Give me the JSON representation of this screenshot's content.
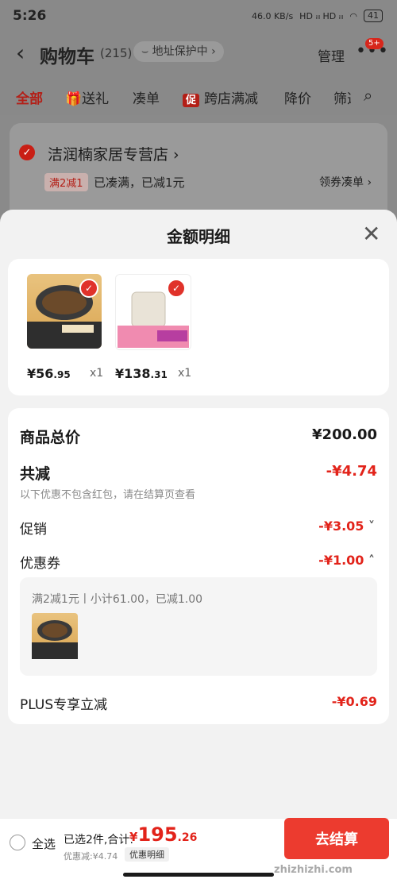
{
  "status_bar": {
    "time": "5:26",
    "net_speed": "46.0 KB/s",
    "signal": "HD ᵢₗₗ  HD ᵢₗₗ",
    "wifi": "◠",
    "battery": "41"
  },
  "header": {
    "title": "购物车",
    "count": "(215)",
    "address_protect": "地址保护中",
    "manage": "管理",
    "badge": "5+"
  },
  "tabs": [
    "全部",
    "送礼",
    "凑单",
    "跨店满减",
    "降价",
    "筛选"
  ],
  "tabs_promo_tag": "促",
  "store": {
    "name": "洁润楠家居专营店",
    "coupon_tag": "满2减1",
    "coupon_info": "已凑满，已减1元",
    "coupon_link": "领券凑单"
  },
  "sheet": {
    "title": "金额明细",
    "products": [
      {
        "price_int": "¥56",
        "price_dec": ".95",
        "qty": "x1"
      },
      {
        "price_int": "¥138",
        "price_dec": ".31",
        "qty": "x1"
      }
    ],
    "rows": {
      "total_label": "商品总价",
      "total_value": "¥200.00",
      "reduce_label": "共减",
      "reduce_value": "-¥4.74",
      "reduce_note": "以下优惠不包含红包，请在结算页查看",
      "promo_label": "促销",
      "promo_value": "-¥3.05",
      "coupon_label": "优惠券",
      "coupon_value": "-¥1.00",
      "coupon_detail": "满2减1元丨小计61.00，已减1.00",
      "plus_label": "PLUS专享立减",
      "plus_value": "-¥0.69"
    }
  },
  "bottom": {
    "select_all": "全选",
    "selected": "已选2件,合计:",
    "total_symbol": "¥",
    "total_int": "195",
    "total_dec": ".26",
    "discount": "优惠减:¥4.74",
    "detail_button": "优惠明细",
    "checkout": "去结算"
  },
  "watermark": "zhizhizhi.com"
}
